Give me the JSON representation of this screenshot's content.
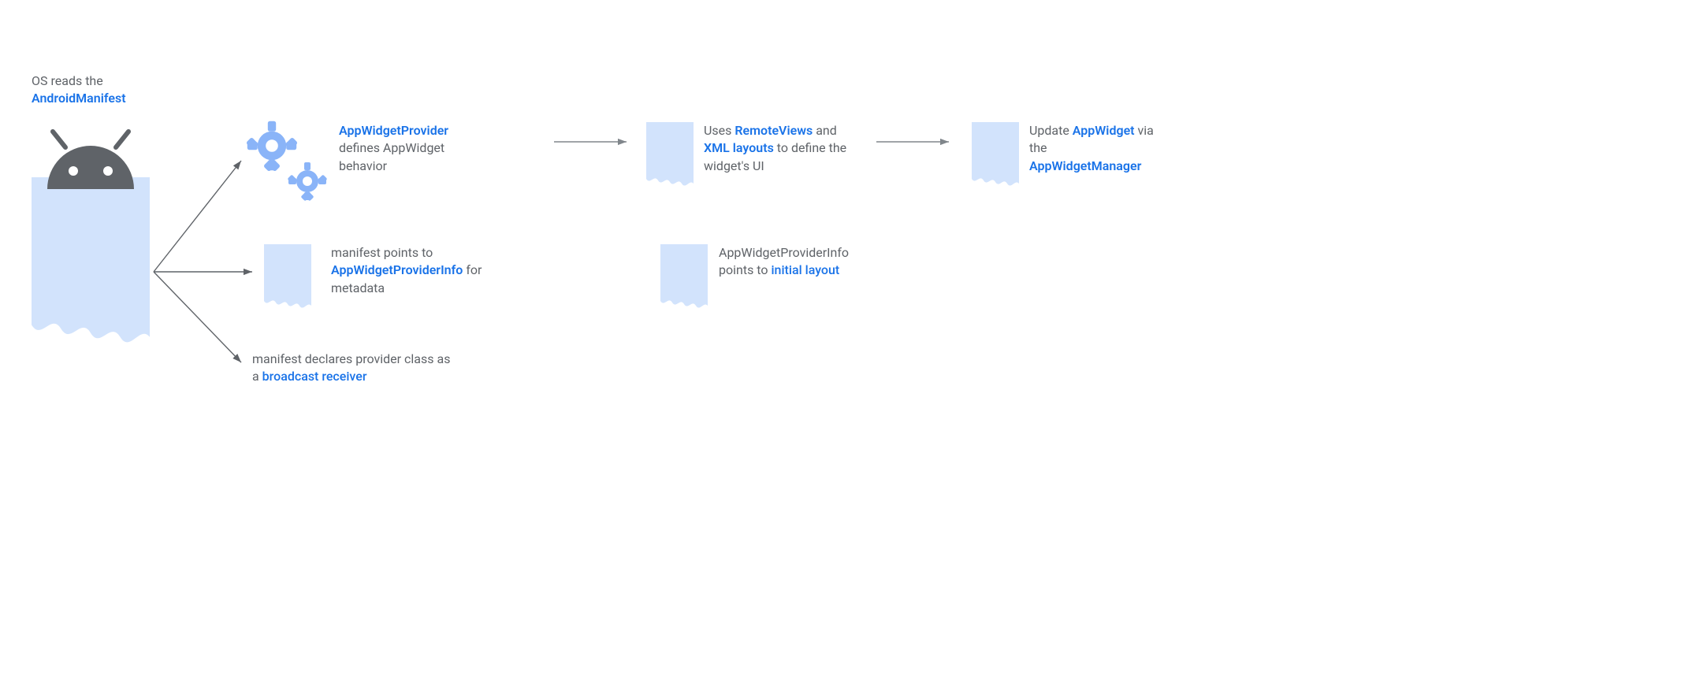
{
  "header": {
    "line1": "OS reads the",
    "line2": "AndroidManifest"
  },
  "provider": {
    "title": "AppWidgetProvider",
    "desc1": "defines AppWidget",
    "desc2": "behavior"
  },
  "remoteviews": {
    "pre": "Uses ",
    "hl1": "RemoteViews",
    "and": " and",
    "hl2": "XML layouts",
    "rest": " to define the",
    "line3": "widget's UI"
  },
  "update": {
    "pre": "Update ",
    "hl": "AppWidget",
    "post": " via",
    "line2": "the",
    "line3": "AppWidgetManager"
  },
  "providerinfo": {
    "line1": "manifest points to",
    "hl": "AppWidgetProviderInfo",
    "rest": " for",
    "line3": "metadata"
  },
  "initiallayout": {
    "line1": "AppWidgetProviderInfo",
    "pre": "points to ",
    "hl": "initial layout"
  },
  "broadcast": {
    "line1": "manifest declares provider class as",
    "pre": "a ",
    "hl": "broadcast receiver"
  }
}
